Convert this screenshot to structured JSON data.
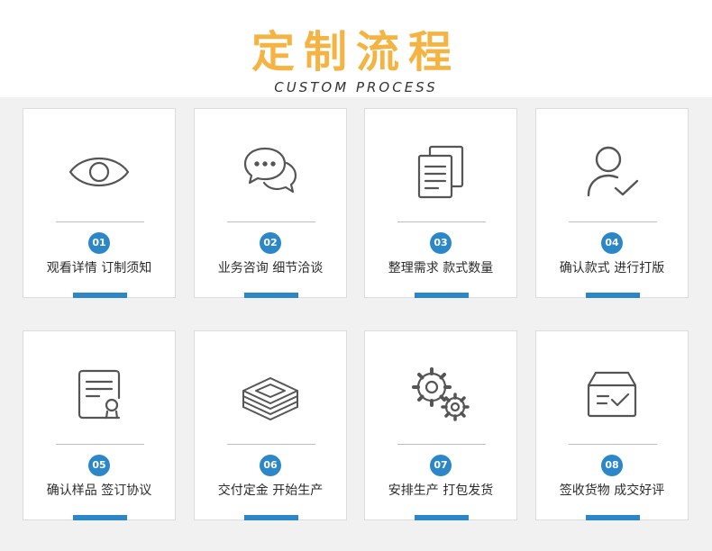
{
  "header": {
    "title": "定制流程",
    "subtitle": "CUSTOM PROCESS"
  },
  "colors": {
    "title": "#f5b341",
    "accent_blue": "#2c87c8",
    "panel_bg": "#f1f1f1",
    "icon_stroke": "#555555"
  },
  "steps": [
    {
      "number": "01",
      "label": "观看详情 订制须知",
      "icon": "eye-icon"
    },
    {
      "number": "02",
      "label": "业务咨询 细节洽谈",
      "icon": "chat-bubbles-icon"
    },
    {
      "number": "03",
      "label": "整理需求 款式数量",
      "icon": "documents-icon"
    },
    {
      "number": "04",
      "label": "确认款式 进行打版",
      "icon": "user-check-icon"
    },
    {
      "number": "05",
      "label": "确认样品 签订协议",
      "icon": "certificate-icon"
    },
    {
      "number": "06",
      "label": "交付定金 开始生产",
      "icon": "money-stack-icon"
    },
    {
      "number": "07",
      "label": "安排生产 打包发货",
      "icon": "gears-icon"
    },
    {
      "number": "08",
      "label": "签收货物 成交好评",
      "icon": "inbox-check-icon"
    }
  ]
}
